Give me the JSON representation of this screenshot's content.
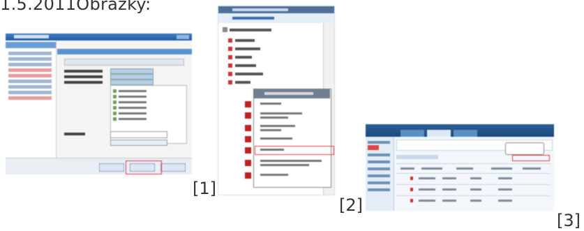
{
  "heading": "1.5.2011Obrázky:",
  "thumbnails": [
    {
      "caption": "[1]"
    },
    {
      "caption": "[2]"
    },
    {
      "caption": "[3]"
    }
  ]
}
